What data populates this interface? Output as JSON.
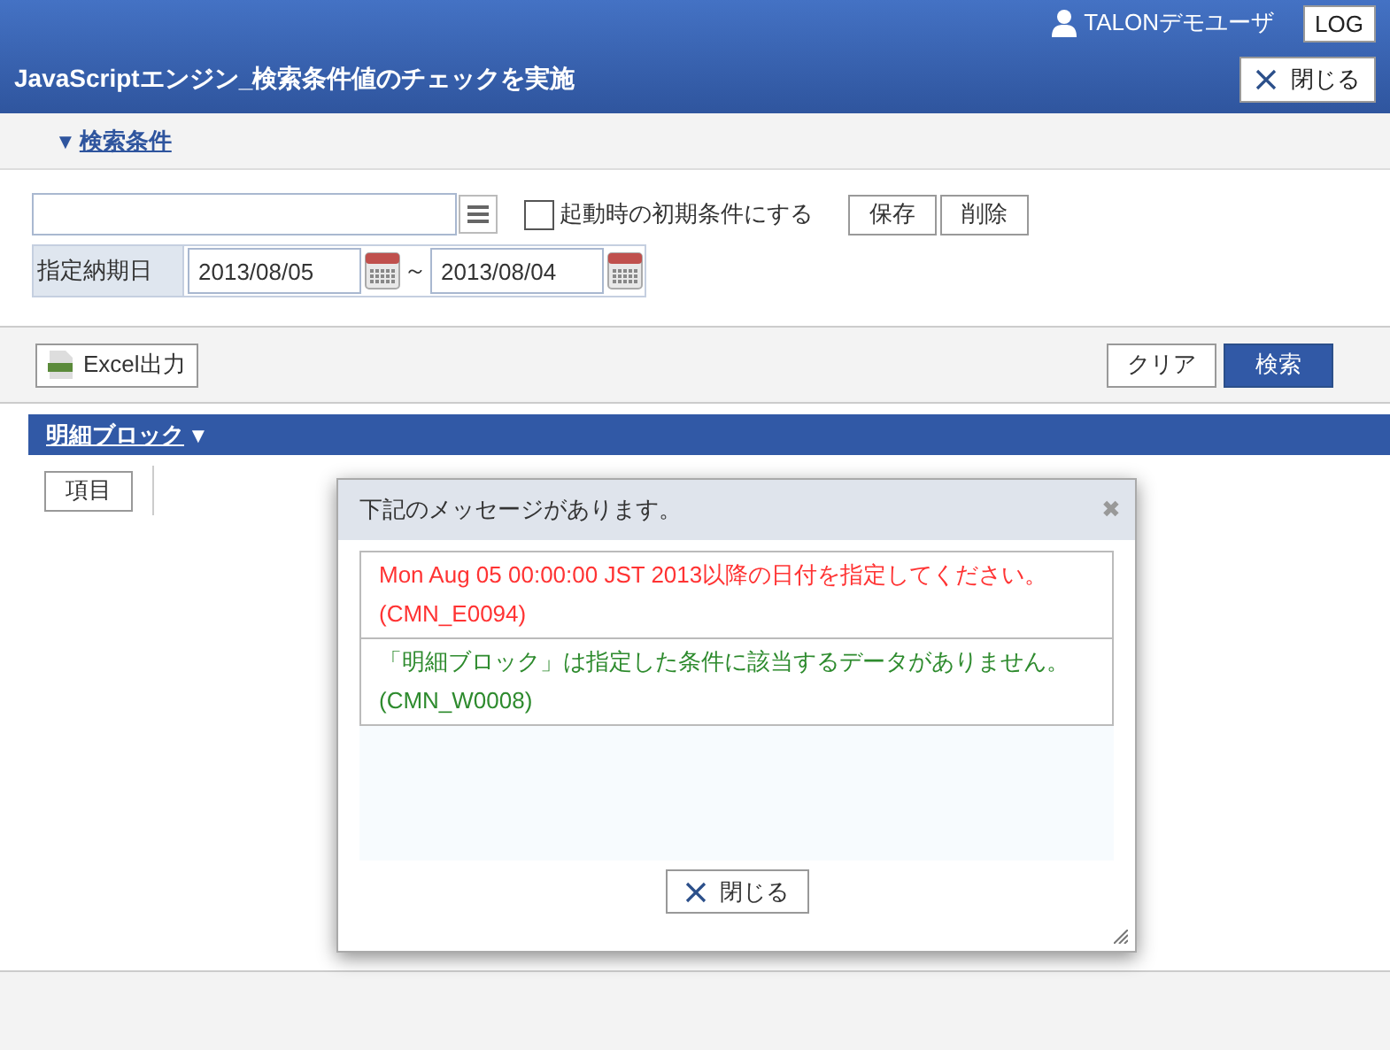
{
  "header": {
    "user": "TALONデモユーザ",
    "logout": "LOG",
    "title": "JavaScriptエンジン_検索条件値のチェックを実施",
    "close": "閉じる"
  },
  "search_section": {
    "toggle": "▼",
    "label": "検索条件",
    "expanded": true
  },
  "condition": {
    "initial_checkbox": {
      "label": "起動時の初期条件にする",
      "checked": false
    },
    "buttons": [
      "保存",
      "削除"
    ]
  },
  "date_range": {
    "label": "指定納期日",
    "from": "2013/08/05",
    "separator": "～",
    "to": "2013/08/04"
  },
  "toolbar": {
    "excel": "Excel出力",
    "clear": "クリア",
    "search": "検索"
  },
  "detail_block": {
    "label": "明細ブロック",
    "toggle": "▼",
    "column_button": "項目"
  },
  "dialog": {
    "title": "下記のメッセージがあります。",
    "close_mark": "✖",
    "messages": [
      {
        "kind": "error",
        "text": "Mon Aug 05 00:00:00 JST 2013以降の日付を指定してください。",
        "code": "(CMN_E0094)"
      },
      {
        "kind": "warning",
        "text": "「明細ブロック」は指定した条件に該当するデータがありません。",
        "code": "(CMN_W0008)"
      }
    ],
    "close": "閉じる"
  }
}
